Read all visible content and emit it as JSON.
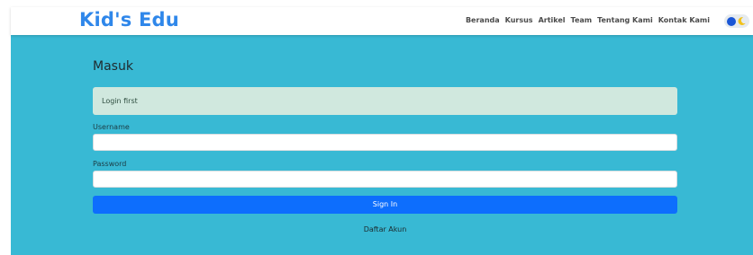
{
  "header": {
    "brand": "Kid's Edu",
    "nav": [
      "Beranda",
      "Kursus",
      "Artikel",
      "Team",
      "Tentang Kami",
      "Kontak Kami"
    ],
    "theme_toggle_icon": "moon-icon"
  },
  "login": {
    "title": "Masuk",
    "alert": "Login first",
    "username_label": "Username",
    "username_value": "",
    "password_label": "Password",
    "password_value": "",
    "submit_label": "Sign In",
    "register_link": "Daftar Akun"
  },
  "colors": {
    "brand": "#2f87ea",
    "background": "#38b9d4",
    "alert_bg": "#d0e8de",
    "primary_button": "#0d6efd",
    "toggle_knob": "#1a56d6",
    "moon": "#f2c21b"
  }
}
